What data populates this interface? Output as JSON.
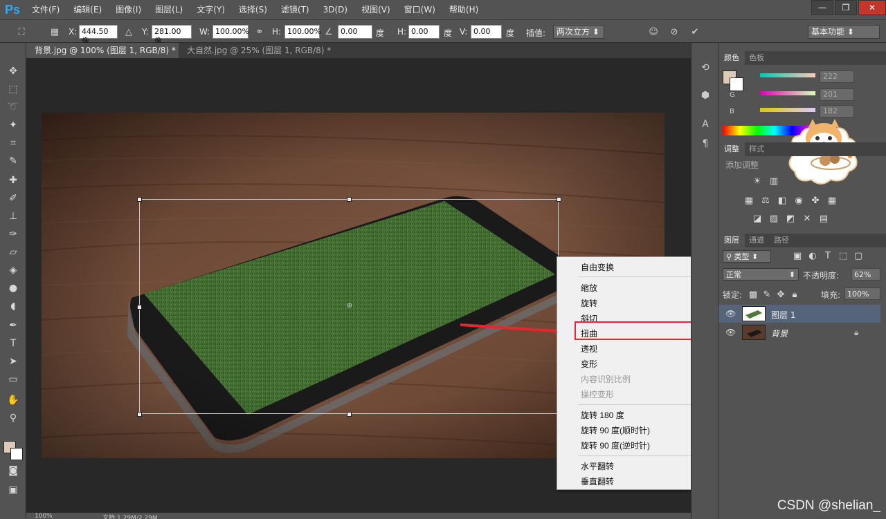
{
  "app": {
    "logo": "Ps"
  },
  "menu": [
    "文件(F)",
    "编辑(E)",
    "图像(I)",
    "图层(L)",
    "文字(Y)",
    "选择(S)",
    "滤镜(T)",
    "3D(D)",
    "视图(V)",
    "窗口(W)",
    "帮助(H)"
  ],
  "window_controls": {
    "minimize": "—",
    "restore": "❐",
    "close": "✕"
  },
  "options": {
    "x_label": "X:",
    "x_value": "444.50 像",
    "y_label": "Y:",
    "y_value": "281.00 像",
    "w_label": "W:",
    "w_value": "100.00%",
    "h_label": "H:",
    "h_value": "100.00%",
    "angle_value": "0.00",
    "angle_unit": "度",
    "hskew_label": "H:",
    "hskew_value": "0.00",
    "hskew_unit": "度",
    "vskew_label": "V:",
    "vskew_value": "0.00",
    "vskew_unit": "度",
    "interp_label": "插值:",
    "interp_value": "两次立方",
    "workspace": "基本功能"
  },
  "tabs": [
    {
      "label": "背景.jpg @ 100% (图层 1, RGB/8) *",
      "close": "×"
    },
    {
      "label": "大自然.jpg @ 25% (图层 1, RGB/8) *",
      "close": "×"
    }
  ],
  "context_menu": {
    "items": [
      {
        "label": "自由变换",
        "disabled": false
      },
      {
        "label": "缩放",
        "disabled": false
      },
      {
        "label": "旋转",
        "disabled": false
      },
      {
        "label": "斜切",
        "disabled": false
      },
      {
        "label": "扭曲",
        "disabled": false,
        "highlighted": true
      },
      {
        "label": "透视",
        "disabled": false
      },
      {
        "label": "变形",
        "disabled": false
      },
      {
        "label": "内容识别比例",
        "disabled": true
      },
      {
        "label": "操控变形",
        "disabled": true
      },
      {
        "label": "旋转 180 度",
        "disabled": false
      },
      {
        "label": "旋转 90 度(顺时针)",
        "disabled": false
      },
      {
        "label": "旋转 90 度(逆时针)",
        "disabled": false
      },
      {
        "label": "水平翻转",
        "disabled": false
      },
      {
        "label": "垂直翻转",
        "disabled": false
      }
    ]
  },
  "color_panel": {
    "tabs": [
      "颜色",
      "色板"
    ],
    "r_label": "R",
    "r_value": "222",
    "g_label": "G",
    "g_value": "201",
    "b_label": "B",
    "b_value": "182",
    "foreground": "#dec9b6"
  },
  "adjust_panel": {
    "tabs": [
      "调整",
      "样式"
    ],
    "title": "添加调整"
  },
  "layers_panel": {
    "tabs": [
      "图层",
      "通道",
      "路径"
    ],
    "filter": "类型",
    "blend_mode": "正常",
    "opacity_label": "不透明度:",
    "opacity_value": "62%",
    "lock_label": "锁定:",
    "fill_label": "填充:",
    "fill_value": "100%",
    "layers": [
      {
        "name": "图层 1",
        "selected": true
      },
      {
        "name": "背景",
        "selected": false
      }
    ]
  },
  "status": {
    "zoom": "100%",
    "doc": "文档:1.29M/2.29M"
  },
  "watermark": "CSDN @shelian_",
  "colors": {
    "accent_red": "#e8262d",
    "panel": "#535353",
    "selected_layer": "#56647a"
  }
}
